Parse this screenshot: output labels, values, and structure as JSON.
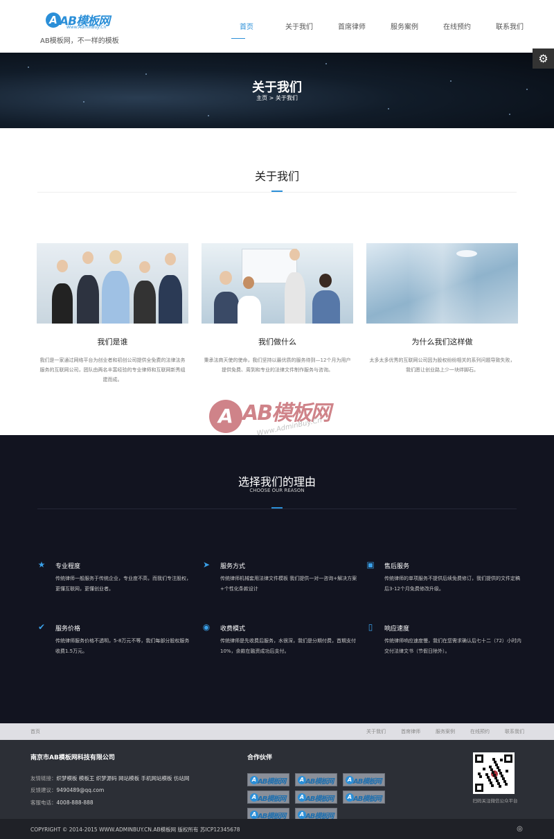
{
  "header": {
    "logo_letters": "AB",
    "logo_text": "AB模板网",
    "logo_sub": "Www.AdminBuy.Cn",
    "slogan": "AB模板网，不一样的模板",
    "nav": [
      "首页",
      "关于我们",
      "首席律师",
      "服务案例",
      "在线预约",
      "联系我们"
    ],
    "active_nav": 0,
    "settings_icon": "gear-icon"
  },
  "banner": {
    "title": "关于我们",
    "breadcrumb": "主页 > 关于我们"
  },
  "about": {
    "title": "关于我们",
    "cards": [
      {
        "title": "我们是谁",
        "desc": "我们是一家通过网络平台为创业者和初创公司提供全免费的法律法务服务的互联网公司，团队由两名丰富经验的专业律师和互联网新秀组建而成。"
      },
      {
        "title": "我们做什么",
        "desc": "秉承法商天使的使命，我们坚持以最优质的服务待到—12个月为用户提供免费、周到和专业的法律文件制作服务与咨询。"
      },
      {
        "title": "为什么我们这样做",
        "desc": "太多太多优秀的互联网公司因为股权纷纷相关的系列问题导致失败，我们愿让创业路上少一块绊脚石。"
      }
    ]
  },
  "watermark": {
    "letter": "A",
    "text": "AB模板网",
    "sub": "Www.AdminBuy.Cn"
  },
  "reasons": {
    "title": "选择我们的理由",
    "subtitle": "CHOOSE OUR REASON",
    "items": [
      {
        "icon": "star-icon",
        "title": "专业程度",
        "desc": "传统律师一般服务于传统企业，专业度不高，而我们专注股权，更懂互联网，更懂创业者。"
      },
      {
        "icon": "rocket-icon",
        "title": "服务方式",
        "desc": "传统律师机械套用法律文件模板 我们提供一对一咨询+解决方案+个性化条款设计"
      },
      {
        "icon": "gift-icon",
        "title": "售后服务",
        "desc": "传统律师的单项服务不提供后续免费修订，我们提供的文件定稿后3-12个月免费修改升级。"
      },
      {
        "icon": "check-circle-icon",
        "title": "服务价格",
        "desc": "传统律师服务价格不透明，5-8万元不等，我们每部分股权服务收费1.5万元。"
      },
      {
        "icon": "dashboard-icon",
        "title": "收费模式",
        "desc": "传统律师是先收费后服务，水很深，我们是分期付费，首期支付10%，余款在融资成功后支付。"
      },
      {
        "icon": "mobile-icon",
        "title": "响应速度",
        "desc": "传统律师响应速度慢，我们在您需求确认后七十二（72）小时内交付法律文书（节假日除外）。"
      }
    ]
  },
  "subnav": {
    "home": "首页",
    "links": [
      "关于我们",
      "首席律师",
      "服务案例",
      "在线预约",
      "联系我们"
    ]
  },
  "footer": {
    "company": "南京市AB模板网科技有限公司",
    "friend_links_label": "友情链接：",
    "friend_links": "织梦模板 模板王 织梦源码 网站模板 手机网站模板 仿站网",
    "feedback_label": "反馈建议：",
    "feedback": "9490489@qq.com",
    "phone_label": "客服电话：",
    "phone": "4008-888-888",
    "partners_title": "合作伙伴",
    "partner_logo_text": "AB模板网",
    "partner_count": 8,
    "qr_caption": "扫码关注微信公众平台"
  },
  "copyright": {
    "text": "COPYRIGHT © 2014-2015 WWW.ADMINBUY.CN.AB模板网 版权所有   苏ICP12345678",
    "weibo_icon": "weibo-icon"
  }
}
